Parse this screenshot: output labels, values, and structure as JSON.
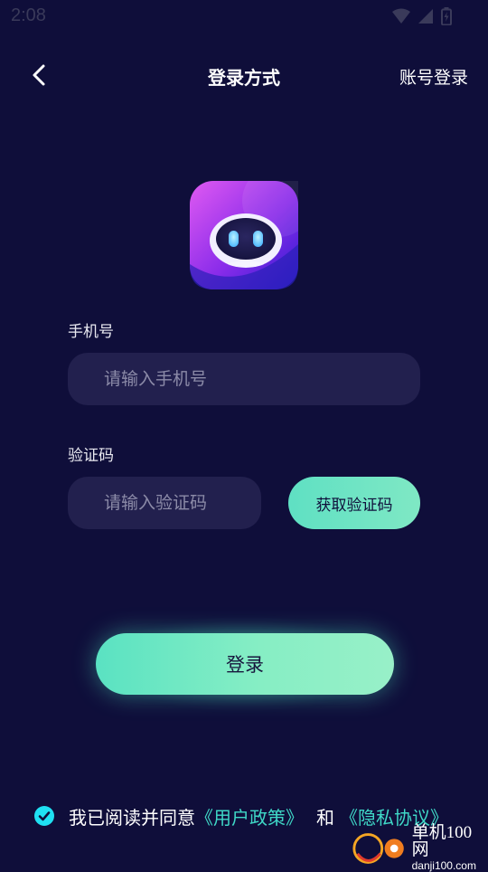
{
  "status_bar": {
    "time": "2:08",
    "icons": [
      "wifi-icon",
      "signal-icon",
      "battery-icon"
    ]
  },
  "nav": {
    "back_icon": "chevron-left-icon",
    "title": "登录方式",
    "right_label": "账号登录"
  },
  "logo": {
    "icon": "robot-icon"
  },
  "form": {
    "phone": {
      "label": "手机号",
      "value": "",
      "placeholder": "请输入手机号"
    },
    "code": {
      "label": "验证码",
      "value": "",
      "placeholder": "请输入验证码",
      "get_code_label": "获取验证码"
    },
    "login_label": "登录"
  },
  "agreement": {
    "checked": true,
    "prefix": "我已阅读并同意",
    "user_policy": "《用户政策》",
    "and": "和",
    "privacy_policy": "《隐私协议》"
  },
  "watermark": {
    "brand": "单机100网",
    "domain": "danji100.com"
  },
  "colors": {
    "background": "#0f0e3a",
    "input_background": "#22204e",
    "accent": "#5fe0c3",
    "link": "#3fd8c7",
    "logo_gradient_start": "#d64cf0",
    "logo_gradient_end": "#3a1fd6"
  }
}
